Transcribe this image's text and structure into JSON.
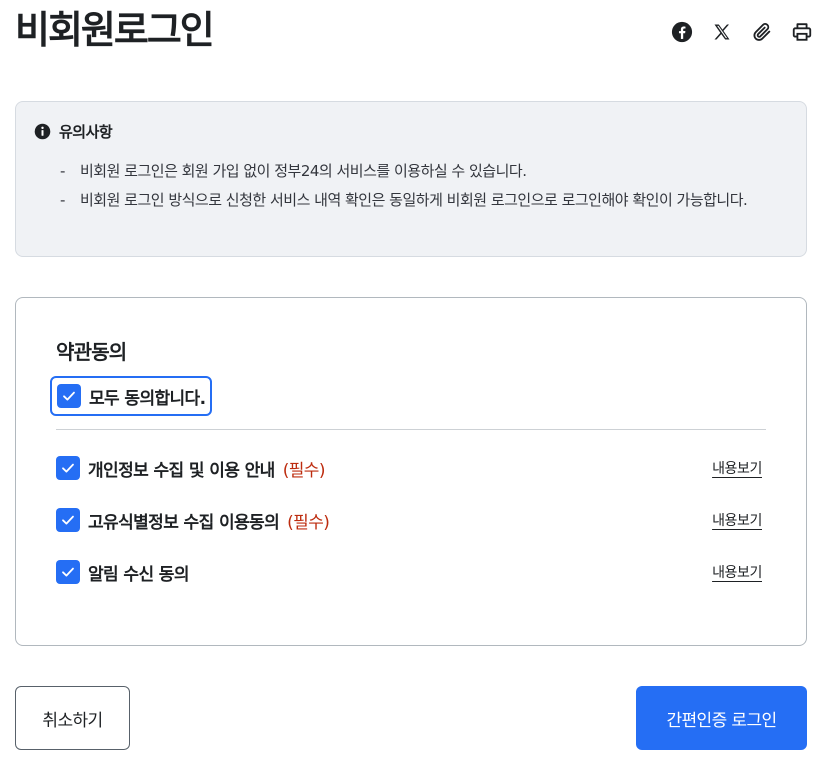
{
  "page": {
    "title": "비회원로그인"
  },
  "share": {
    "icons": [
      "facebook-icon",
      "x-icon",
      "paperclip-icon",
      "print-icon"
    ]
  },
  "notice": {
    "title": "유의사항",
    "icon": "info-icon",
    "items": [
      "비회원 로그인은 회원 가입 없이 정부24의 서비스를 이용하실 수 있습니다.",
      "비회원 로그인 방식으로 신청한 서비스 내역 확인은 동일하게 비회원 로그인으로 로그인해야 확인이 가능합니다."
    ]
  },
  "terms": {
    "title": "약관동의",
    "check_all": {
      "label": "모두 동의합니다.",
      "checked": true
    },
    "items": [
      {
        "label": "개인정보 수집 및 이용 안내",
        "required": "(필수)",
        "link": "내용보기",
        "checked": true
      },
      {
        "label": "고유식별정보 수집 이용동의",
        "required": "(필수)",
        "link": "내용보기",
        "checked": true
      },
      {
        "label": "알림 수신 동의",
        "required": "",
        "link": "내용보기",
        "checked": true
      }
    ]
  },
  "actions": {
    "cancel_label": "취소하기",
    "login_label": "간편인증 로그인"
  },
  "colors": {
    "primary": "#256ef4",
    "required": "#bd2c0f",
    "notice_bg": "#f0f2f5",
    "text": "#1e2124"
  }
}
